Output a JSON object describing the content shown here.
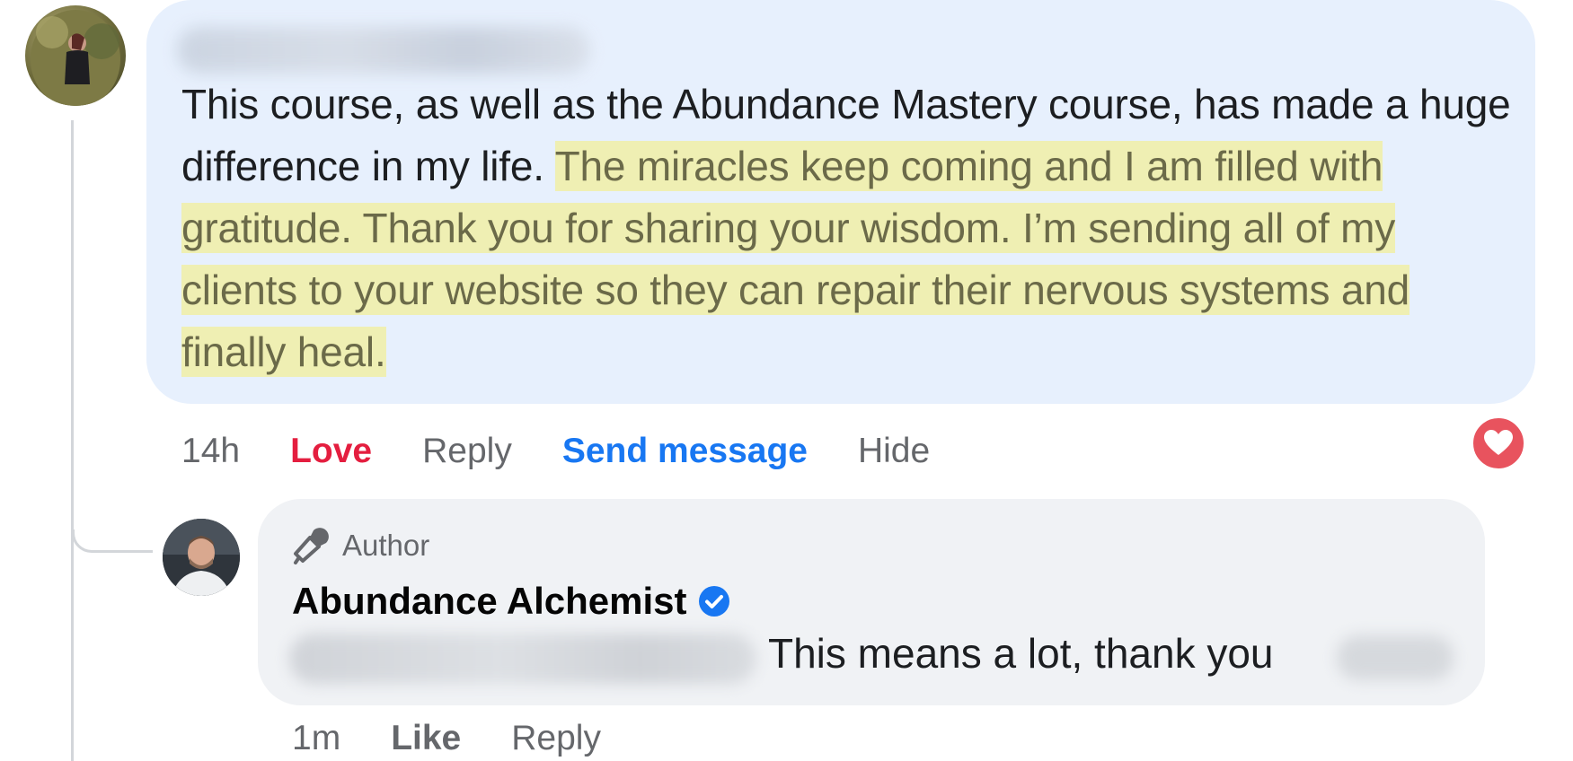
{
  "comment": {
    "text_plain": "This course, as well as the Abundance Mastery course, has made a huge difference in my life. ",
    "text_highlighted": "The miracles keep coming and I am filled with gratitude. Thank you for sharing your wisdom. I’m sending all of my clients to your website so they can repair their nervous systems and finally heal.",
    "highlight_color": "#f3ef96",
    "bubble_color": "#e7f0fd",
    "actions": {
      "time": "14h",
      "love": "Love",
      "reply": "Reply",
      "send_message": "Send message",
      "hide": "Hide"
    },
    "reaction_icon": "heart-icon",
    "love_color": "#e41e3f",
    "link_color": "#1877f2"
  },
  "reply": {
    "badge_icon": "microphone-icon",
    "badge_label": "Author",
    "author_name": "Abundance Alchemist",
    "verified_icon": "verified-badge-icon",
    "text": "This means a lot, thank you",
    "actions": {
      "time": "1m",
      "like": "Like",
      "reply": "Reply"
    }
  }
}
